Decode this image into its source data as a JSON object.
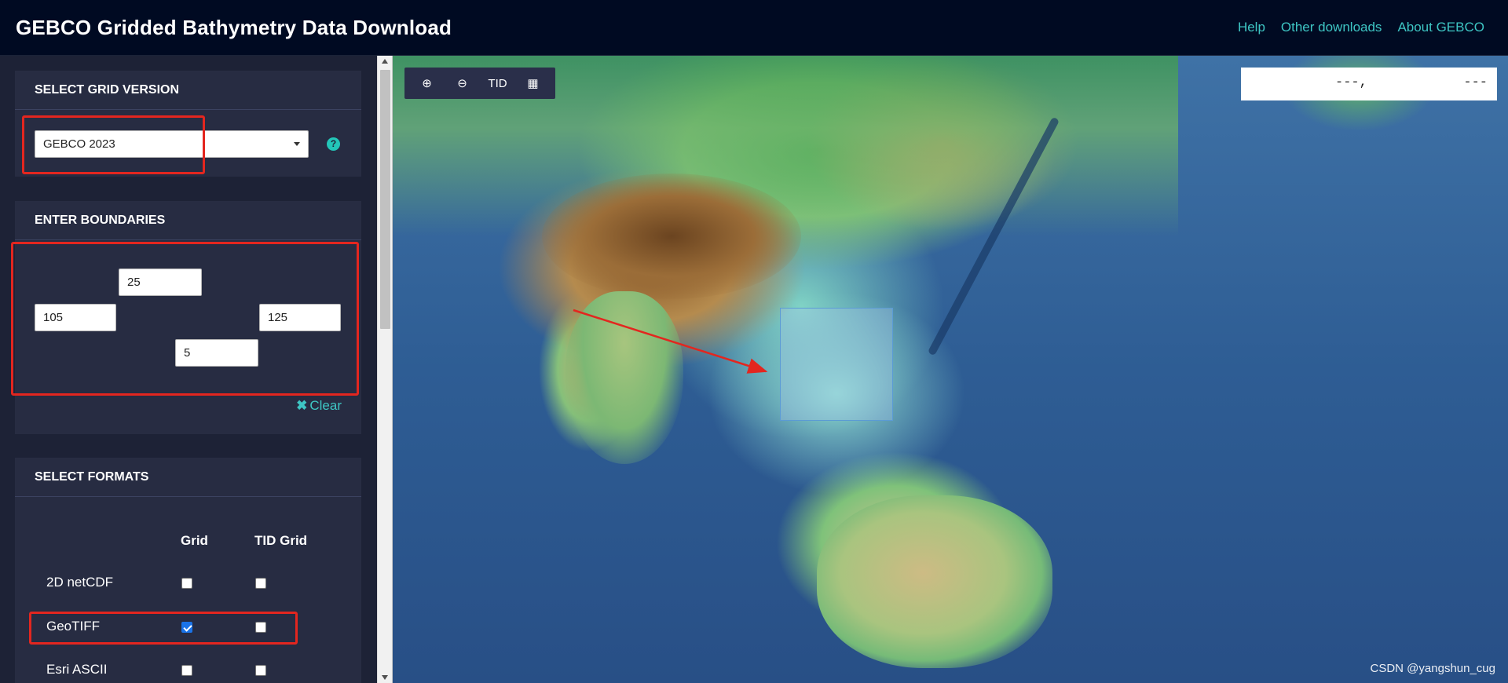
{
  "header": {
    "title": "GEBCO Gridded Bathymetry Data Download",
    "nav": [
      "Help",
      "Other downloads",
      "About GEBCO"
    ]
  },
  "grid_version": {
    "title": "SELECT GRID VERSION",
    "selected": "GEBCO 2023",
    "help_icon": "?"
  },
  "boundaries": {
    "title": "ENTER BOUNDARIES",
    "north": "25",
    "west": "105",
    "east": "125",
    "south": "5",
    "clear_label": "Clear",
    "clear_icon": "✖"
  },
  "formats": {
    "title": "SELECT FORMATS",
    "columns": [
      "Grid",
      "TID Grid"
    ],
    "rows": [
      {
        "label": "2D netCDF",
        "grid": false,
        "tid": false
      },
      {
        "label": "GeoTIFF",
        "grid": true,
        "tid": false
      },
      {
        "label": "Esri ASCII",
        "grid": false,
        "tid": false
      }
    ]
  },
  "map": {
    "toolbar": {
      "zoom_in": "⊕",
      "zoom_out": "⊖",
      "tid": "TID",
      "grid": "▦"
    },
    "coords": {
      "lat": "---,",
      "lon": "---"
    },
    "watermark": "CSDN @yangshun_cug"
  },
  "colors": {
    "header_bg": "#000a22",
    "sidebar_bg": "#1d2236",
    "panel_bg": "#272c42",
    "accent": "#3ec6c4",
    "annotation_red": "#e3261f"
  }
}
